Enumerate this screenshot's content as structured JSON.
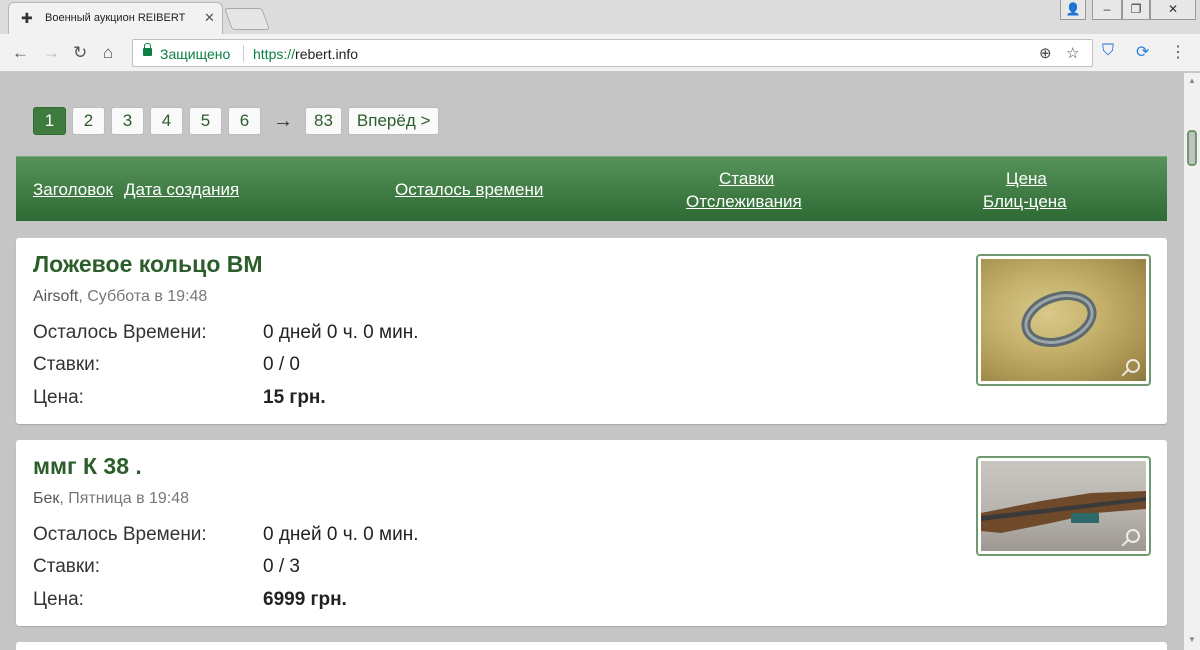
{
  "browser": {
    "tab_title": "Военный аукцион REIBERT",
    "secure_label": "Защищено",
    "url_scheme": "https://",
    "url_host": "rebert.info"
  },
  "pager": {
    "pages": [
      "1",
      "2",
      "3",
      "4",
      "5",
      "6"
    ],
    "current": "1",
    "arrow": "→",
    "last": "83",
    "next": "Вперёд >"
  },
  "header": {
    "title_col": "Заголовок",
    "date_col": "Дата создания",
    "time_left_col": "Осталось времени",
    "bids_col": "Ставки",
    "watch_col": "Отслеживания",
    "price_col": "Цена",
    "blitz_col": "Блиц-цена"
  },
  "lots": [
    {
      "title": "Ложевое кольцо ВМ",
      "seller": "Airsoft",
      "created": "Суббота в 19:48",
      "time_label": "Осталось Времени:",
      "time_value": "0 дней 0 ч. 0 мин.",
      "bids_label": "Ставки:",
      "bids_value": "0 / 0",
      "price_label": "Цена:",
      "price_value": "15 грн."
    },
    {
      "title": "ммг К 38 .",
      "seller": "Бек",
      "created": "Пятница в 19:48",
      "time_label": "Осталось Времени:",
      "time_value": "0 дней 0 ч. 0 мин.",
      "bids_label": "Ставки:",
      "bids_value": "0 / 3",
      "price_label": "Цена:",
      "price_value": "6999 грн."
    }
  ],
  "colors": {
    "accent": "#3f7a3f",
    "header_top": "#56935a",
    "header_bottom": "#2e6a33",
    "title_text": "#2b5e2b",
    "secure": "#0b8043"
  }
}
